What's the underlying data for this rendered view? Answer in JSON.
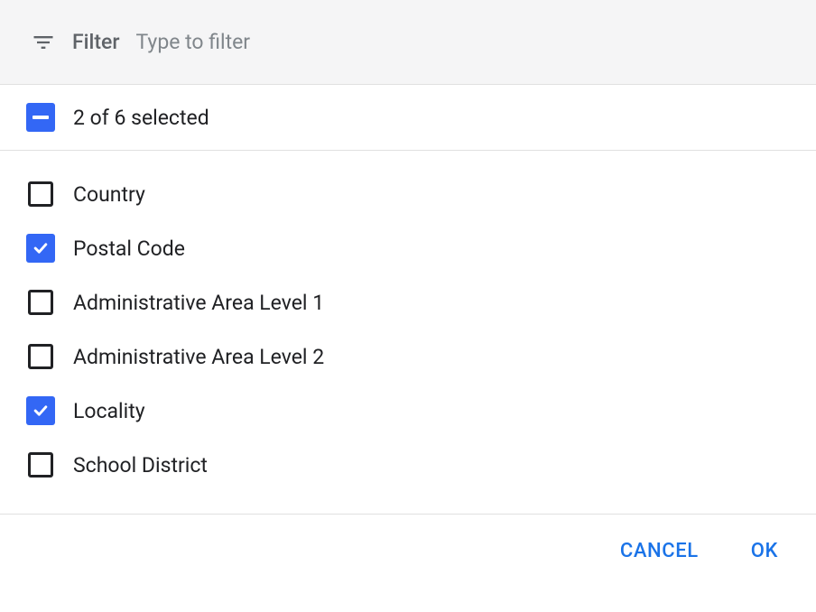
{
  "filter": {
    "label": "Filter",
    "placeholder": "Type to filter",
    "value": ""
  },
  "selection": {
    "selected_count": 2,
    "total_count": 6,
    "summary_text": "2 of 6 selected",
    "state": "indeterminate"
  },
  "options": [
    {
      "label": "Country",
      "checked": false
    },
    {
      "label": "Postal Code",
      "checked": true
    },
    {
      "label": "Administrative Area Level 1",
      "checked": false
    },
    {
      "label": "Administrative Area Level 2",
      "checked": false
    },
    {
      "label": "Locality",
      "checked": true
    },
    {
      "label": "School District",
      "checked": false
    }
  ],
  "actions": {
    "cancel": "CANCEL",
    "ok": "OK"
  },
  "colors": {
    "accent": "#3367f5",
    "action_text": "#1a73e8",
    "text_primary": "#202124",
    "text_secondary": "#5f6368",
    "filter_bg": "#f5f5f6",
    "border": "#e0e0e0"
  }
}
